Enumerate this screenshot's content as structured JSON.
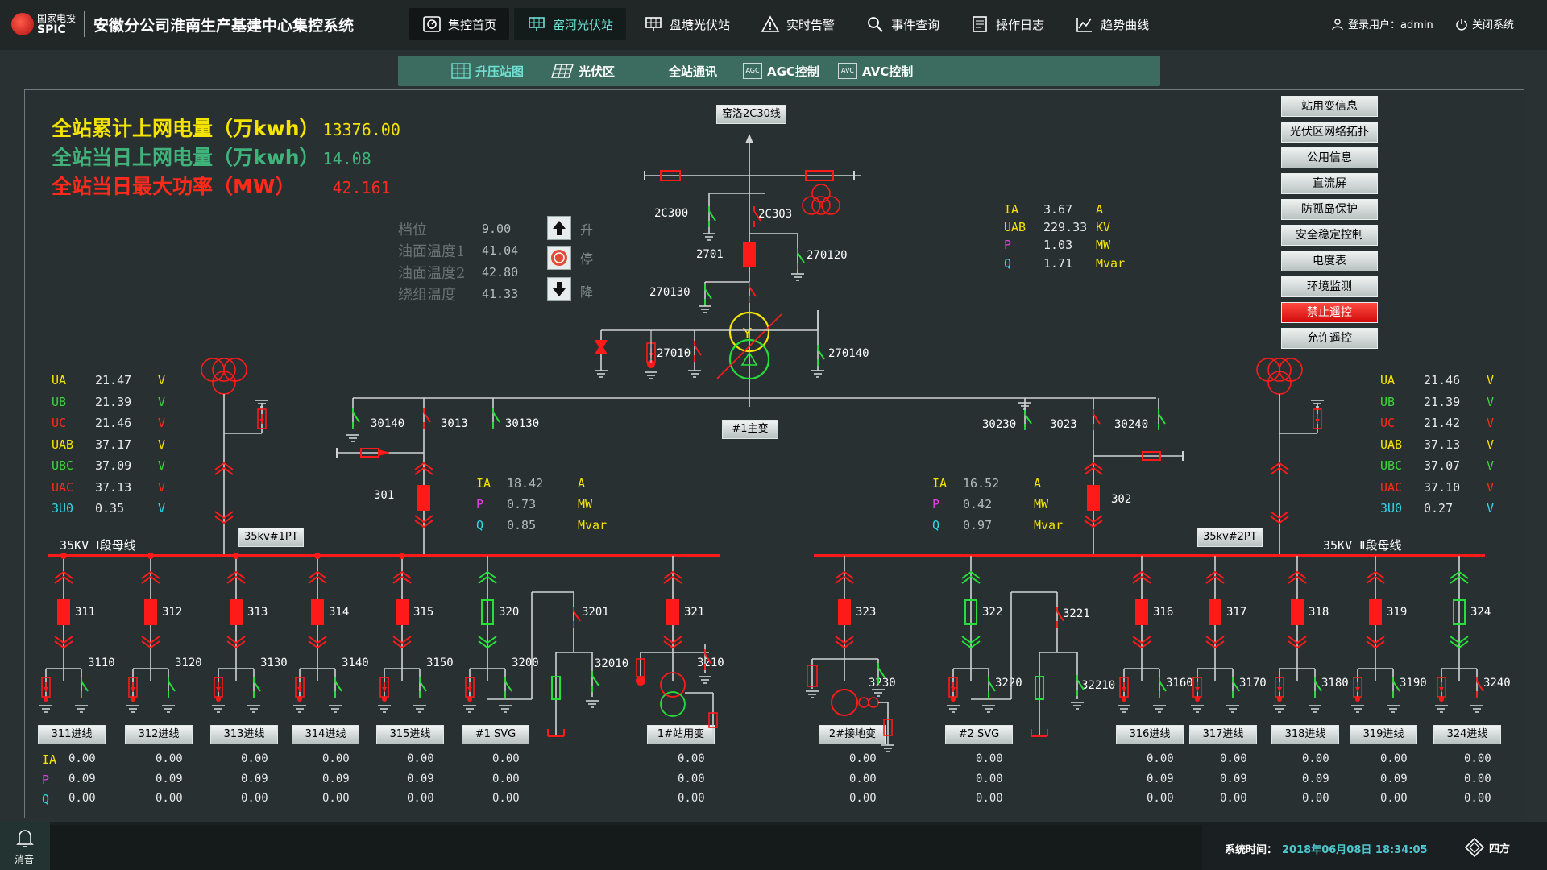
{
  "header": {
    "logo_cn": "国家电投",
    "logo_en": "SPIC",
    "title": "安徽分公司淮南生产基建中心集控系统",
    "nav": [
      {
        "label": "集控首页",
        "icon": "gauge-icon"
      },
      {
        "label": "窑河光伏站",
        "icon": "panel-icon"
      },
      {
        "label": "盘塘光伏站",
        "icon": "panel-icon"
      },
      {
        "label": "实时告警",
        "icon": "warning-icon"
      },
      {
        "label": "事件查询",
        "icon": "search-icon"
      },
      {
        "label": "操作日志",
        "icon": "log-icon"
      },
      {
        "label": "趋势曲线",
        "icon": "trend-icon"
      }
    ],
    "user": "登录用户：admin",
    "logout": "关闭系统"
  },
  "subnav": [
    {
      "label": "升压站图",
      "icon": "substation-icon"
    },
    {
      "label": "光伏区",
      "icon": "solar-icon"
    },
    {
      "label": "全站通讯",
      "icon": ""
    },
    {
      "label": "AGC控制",
      "icon": "AGC"
    },
    {
      "label": "AVC控制",
      "icon": "AVC"
    }
  ],
  "stats": {
    "total_label": "全站累计上网电量（万kwh）",
    "total_value": "13376.00",
    "today_label": "全站当日上网电量（万kwh）",
    "today_value": "14.08",
    "maxp_label": "全站当日最大功率（MW）",
    "maxp_value": "42.161",
    "colors": {
      "total": "#f5e400",
      "today": "#3fb37a",
      "maxp": "#ff2a1a"
    }
  },
  "transformer": {
    "rows": [
      {
        "label": "档位",
        "value": "9.00"
      },
      {
        "label": "油面温度1",
        "value": "41.04"
      },
      {
        "label": "油面温度2",
        "value": "42.80"
      },
      {
        "label": "绕组温度",
        "value": "41.33"
      }
    ],
    "ctl": [
      {
        "label": "升",
        "icon": "arrow-up-icon"
      },
      {
        "label": "停",
        "icon": "stop-icon"
      },
      {
        "label": "降",
        "icon": "arrow-down-icon"
      }
    ],
    "name": "#1主变"
  },
  "line": {
    "name": "窑洛2C30线",
    "meas": [
      {
        "k": "IA",
        "v": "3.67",
        "u": "A"
      },
      {
        "k": "UAB",
        "v": "229.33",
        "u": "KV"
      },
      {
        "k": "P",
        "v": "1.03",
        "u": "MW"
      },
      {
        "k": "Q",
        "v": "1.71",
        "u": "Mvar"
      }
    ]
  },
  "hv_tags": [
    "2C300",
    "2C303",
    "2701",
    "270120",
    "270130",
    "27010",
    "270140"
  ],
  "right_buttons": [
    "站用变信息",
    "光伏区网络拓扑",
    "公用信息",
    "直流屏",
    "防孤岛保护",
    "安全稳定控制",
    "电度表",
    "环境监测",
    "禁止遥控",
    "允许遥控"
  ],
  "left_volt": [
    {
      "k": "UA",
      "v": "21.47",
      "u": "V"
    },
    {
      "k": "UB",
      "v": "21.39",
      "u": "V"
    },
    {
      "k": "UC",
      "v": "21.46",
      "u": "V"
    },
    {
      "k": "UAB",
      "v": "37.17",
      "u": "V"
    },
    {
      "k": "UBC",
      "v": "37.09",
      "u": "V"
    },
    {
      "k": "UAC",
      "v": "37.13",
      "u": "V"
    },
    {
      "k": "3U0",
      "v": "0.35",
      "u": "V"
    }
  ],
  "right_volt": [
    {
      "k": "UA",
      "v": "21.46",
      "u": "V"
    },
    {
      "k": "UB",
      "v": "21.39",
      "u": "V"
    },
    {
      "k": "UC",
      "v": "21.42",
      "u": "V"
    },
    {
      "k": "UAB",
      "v": "37.13",
      "u": "V"
    },
    {
      "k": "UBC",
      "v": "37.07",
      "u": "V"
    },
    {
      "k": "UAC",
      "v": "37.10",
      "u": "V"
    },
    {
      "k": "3U0",
      "v": "0.27",
      "u": "V"
    }
  ],
  "left_branch": {
    "tags": [
      "30140",
      "3013",
      "30130",
      "301"
    ],
    "meas": [
      {
        "k": "IA",
        "v": "18.42",
        "u": "A"
      },
      {
        "k": "P",
        "v": "0.73",
        "u": "MW"
      },
      {
        "k": "Q",
        "v": "0.85",
        "u": "Mvar"
      }
    ]
  },
  "right_branch": {
    "tags": [
      "30230",
      "3023",
      "30240",
      "302"
    ],
    "meas": [
      {
        "k": "IA",
        "v": "16.52",
        "u": "A"
      },
      {
        "k": "P",
        "v": "0.42",
        "u": "MW"
      },
      {
        "k": "Q",
        "v": "0.97",
        "u": "Mvar"
      }
    ]
  },
  "bus": {
    "left_name": "35KV Ⅰ段母线",
    "right_name": "35KV Ⅱ段母线",
    "left_pt": "35kv#1PT",
    "right_pt": "35kv#2PT"
  },
  "meas_keys": [
    "IA",
    "P",
    "Q"
  ],
  "feeders_left": [
    {
      "bk": "311",
      "sw": "3110",
      "name": "311进线",
      "vals": [
        "0.00",
        "0.09",
        "0.00"
      ]
    },
    {
      "bk": "312",
      "sw": "3120",
      "name": "312进线",
      "vals": [
        "0.00",
        "0.09",
        "0.00"
      ]
    },
    {
      "bk": "313",
      "sw": "3130",
      "name": "313进线",
      "vals": [
        "0.00",
        "0.09",
        "0.00"
      ]
    },
    {
      "bk": "314",
      "sw": "3140",
      "name": "314进线",
      "vals": [
        "0.00",
        "0.09",
        "0.00"
      ]
    },
    {
      "bk": "315",
      "sw": "3150",
      "name": "315进线",
      "vals": [
        "0.00",
        "0.09",
        "0.00"
      ]
    },
    {
      "bk": "320",
      "sw": "3200",
      "name": "#1 SVG",
      "vals": [
        "0.00",
        "0.00",
        "0.00"
      ]
    },
    {
      "bk": "321",
      "sw": "3210",
      "name": "1#站用变",
      "vals": [
        "0.00",
        "0.00",
        "0.00"
      ]
    }
  ],
  "feeders_left_extra": [
    "3201",
    "32010"
  ],
  "feeders_right": [
    {
      "bk": "323",
      "sw": "3230",
      "name": "2#接地变",
      "vals": [
        "0.00",
        "0.00",
        "0.00"
      ]
    },
    {
      "bk": "322",
      "sw": "3220",
      "name": "#2 SVG",
      "vals": [
        "0.00",
        "0.00",
        "0.00"
      ]
    },
    {
      "bk": "316",
      "sw": "3160",
      "name": "316进线",
      "vals": [
        "0.00",
        "0.09",
        "0.00"
      ]
    },
    {
      "bk": "317",
      "sw": "3170",
      "name": "317进线",
      "vals": [
        "0.00",
        "0.09",
        "0.00"
      ]
    },
    {
      "bk": "318",
      "sw": "3180",
      "name": "318进线",
      "vals": [
        "0.00",
        "0.09",
        "0.00"
      ]
    },
    {
      "bk": "319",
      "sw": "3190",
      "name": "319进线",
      "vals": [
        "0.00",
        "0.09",
        "0.00"
      ]
    },
    {
      "bk": "324",
      "sw": "3240",
      "name": "324进线",
      "vals": [
        "0.00",
        "0.00",
        "0.00"
      ]
    }
  ],
  "feeders_right_extra": [
    "3221",
    "32210"
  ],
  "status": {
    "alarm": "消音",
    "time_label": "系统时间：",
    "time_value": "2018年06月08日 18:34:05",
    "brand": "四方"
  },
  "colors": {
    "closed": "#ff1a1a",
    "open": "#26e03a",
    "bus": "#ff1a1a",
    "line": "#cfd3d3",
    "yellow": "#f5e400",
    "magenta": "#e63fe6",
    "cyan": "#30d8e8",
    "green": "#3fd43f"
  }
}
